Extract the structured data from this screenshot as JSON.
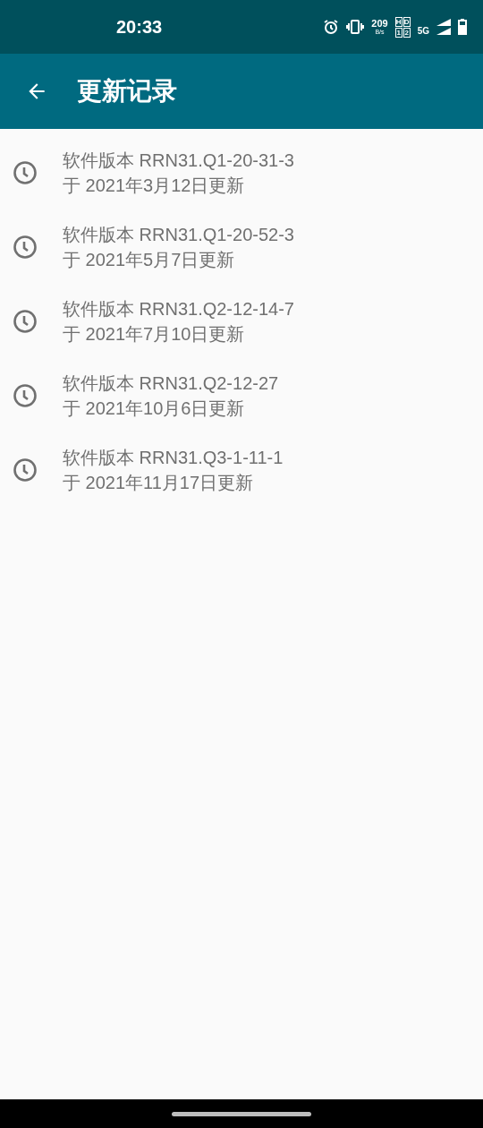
{
  "status_bar": {
    "time": "20:33",
    "net_speed": "209",
    "net_unit": "B/s",
    "hd_marks": [
      "H",
      "D",
      "1",
      "2"
    ],
    "network": "5G"
  },
  "app_bar": {
    "title": "更新记录"
  },
  "updates": [
    {
      "version": "软件版本 RRN31.Q1-20-31-3",
      "date": "于 2021年3月12日更新"
    },
    {
      "version": "软件版本 RRN31.Q1-20-52-3",
      "date": "于 2021年5月7日更新"
    },
    {
      "version": "软件版本 RRN31.Q2-12-14-7",
      "date": "于 2021年7月10日更新"
    },
    {
      "version": "软件版本 RRN31.Q2-12-27",
      "date": "于 2021年10月6日更新"
    },
    {
      "version": "软件版本 RRN31.Q3-1-11-1",
      "date": "于 2021年11月17日更新"
    }
  ]
}
